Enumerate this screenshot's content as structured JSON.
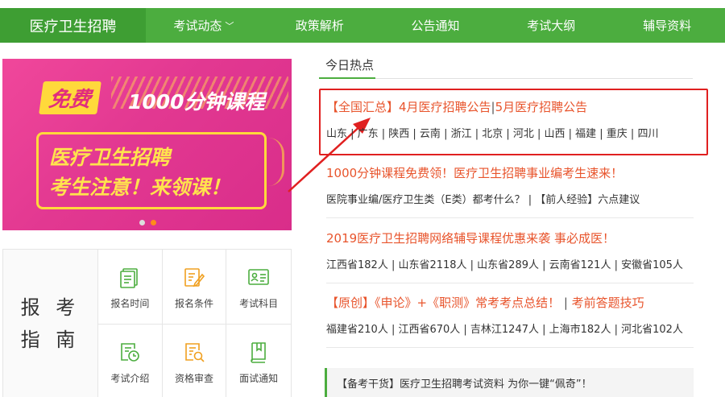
{
  "nav": {
    "brand": "医疗卫生招聘",
    "items": [
      {
        "label": "考试动态",
        "has_dropdown": true
      },
      {
        "label": "政策解析"
      },
      {
        "label": "公告通知"
      },
      {
        "label": "考试大纲"
      },
      {
        "label": "辅导资料"
      }
    ]
  },
  "banner": {
    "free": "免费",
    "course": "1000分钟课程",
    "line1": "医疗卫生招聘",
    "line2": "考生注意！来领课！"
  },
  "guide": {
    "title_line1": "报 考",
    "title_line2": "指 南",
    "items": [
      {
        "label": "报名时间",
        "icon": "list-icon"
      },
      {
        "label": "报名条件",
        "icon": "edit-icon"
      },
      {
        "label": "考试科目",
        "icon": "id-card-icon"
      },
      {
        "label": "考试介绍",
        "icon": "clock-doc-icon"
      },
      {
        "label": "资格审查",
        "icon": "search-doc-icon"
      },
      {
        "label": "面试通知",
        "icon": "book-icon"
      }
    ]
  },
  "hot": {
    "title": "今日热点",
    "news": [
      {
        "headline_a": "【全国汇总】4月医疗招聘公告",
        "headline_sep": "|",
        "headline_b": "5月医疗招聘公告",
        "sub": "山东 | 广东 | 陕西 | 云南 | 浙江 | 北京 | 河北 | 山西 | 福建 | 重庆 | 四川"
      },
      {
        "headline_a": "1000分钟课程免费领！医疗卫生招聘事业编考生速来！",
        "sub": "医院事业编/医疗卫生类（E类）都考什么？ | 【前人经验】六点建议"
      },
      {
        "headline_a": "2019医疗卫生招聘网络辅导课程优惠来袭 事必成医！",
        "sub": "江西省182人 | 山东省2118人 | 山东省289人 | 云南省121人 | 安徽省105人"
      },
      {
        "headline_a": "【原创】《申论》+《职测》常考考点总结！",
        "headline_sep": " | ",
        "headline_b": "考前答题技巧",
        "sub": "福建省210人 | 江西省670人 | 吉林江1247人 | 上海市182人 | 河北省102人"
      }
    ],
    "tip": "【备考干货】医疗卫生招聘考试资料 为你一键“佩奇”！"
  },
  "colors": {
    "green": "#4cad3f",
    "headline": "#e8542c",
    "highlight": "#e02020"
  }
}
